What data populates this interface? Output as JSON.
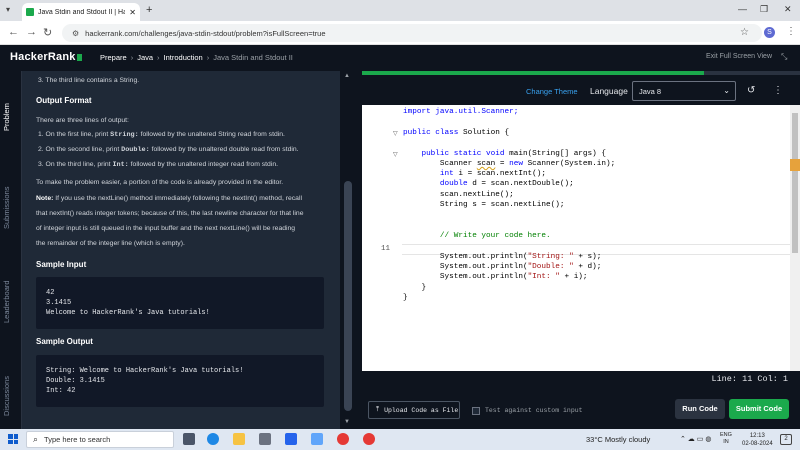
{
  "browser": {
    "tab_title": "Java Stdin and Stdout II | Hacke",
    "url": "hackerrank.com/challenges/java-stdin-stdout/problem?isFullScreen=true",
    "profile_initial": "S"
  },
  "header": {
    "logo": "HackerRank",
    "breadcrumb": [
      "Prepare",
      "Java",
      "Introduction",
      "Java Stdin and Stdout II"
    ],
    "exit_fullscreen": "Exit Full Screen View"
  },
  "side_tabs": [
    "Problem",
    "Submissions",
    "Leaderboard",
    "Discussions"
  ],
  "problem": {
    "intro_item": "3. The third line contains a String.",
    "output_heading": "Output Format",
    "output_intro": "There are three lines of output:",
    "output_items": [
      {
        "prefix": "1. On the first line, print ",
        "code": "String:",
        "suffix": " followed by the unaltered String read from stdin."
      },
      {
        "prefix": "2. On the second line, print ",
        "code": "Double:",
        "suffix": " followed by the unaltered double read from stdin."
      },
      {
        "prefix": "3. On the third line, print ",
        "code": "Int:",
        "suffix": " followed by the unaltered integer read from stdin."
      }
    ],
    "easier_note": "To make the problem easier, a portion of the code is already provided in the editor.",
    "note_label": "Note:",
    "note_lines": [
      " If you use the nextLine() method immediately following the nextInt() method, recall",
      "that nextInt() reads integer tokens; because of this, the last newline character for that line",
      "of integer input is still queued in the input buffer and the next nextLine() will be reading",
      "the remainder of the integer line (which is empty)."
    ],
    "sample_input_heading": "Sample Input",
    "sample_input": [
      "42",
      "3.1415",
      "Welcome to HackerRank's Java tutorials!"
    ],
    "sample_output_heading": "Sample Output",
    "sample_output": [
      "String: Welcome to HackerRank's Java tutorials!",
      "Double: 3.1415",
      "Int: 42"
    ]
  },
  "editor": {
    "change_theme": "Change Theme",
    "language_label": "Language",
    "language_value": "Java 8",
    "progress": 0.78,
    "current_line_number": "11",
    "code": {
      "l1": "import java.util.Scanner;",
      "l3a": "public class",
      "l3b": " Solution {",
      "l5a": "    public static void",
      "l5b": " main(String[] args) {",
      "l6a": "        Scanner ",
      "l6b": "scan",
      "l6c": " = ",
      "l6d": "new",
      "l6e": " Scanner(System.in);",
      "l7a": "        int",
      "l7b": " i = scan.nextInt();",
      "l8a": "        double",
      "l8b": " d = scan.nextDouble();",
      "l9": "        scan.nextLine();",
      "l10": "        String s = scan.nextLine();",
      "l13": "        // Write your code here.",
      "l15a": "        System.out.println(",
      "l15b": "\"String: \"",
      "l15c": " + s);",
      "l16a": "        System.out.println(",
      "l16b": "\"Double: \"",
      "l16c": " + d);",
      "l17a": "        System.out.println(",
      "l17b": "\"Int: \"",
      "l17c": " + i);",
      "l18": "    }",
      "l19": "}"
    },
    "status": "Line: 11 Col: 1",
    "upload_label": "Upload Code as File",
    "custom_input_label": "Test against custom input",
    "run_label": "Run Code",
    "submit_label": "Submit Code"
  },
  "taskbar": {
    "search_placeholder": "Type here to search",
    "weather": "33°C  Mostly cloudy",
    "lang_line1": "ENG",
    "lang_line2": "IN",
    "time": "12:13",
    "date": "02-08-2024",
    "notif_count": "2"
  }
}
